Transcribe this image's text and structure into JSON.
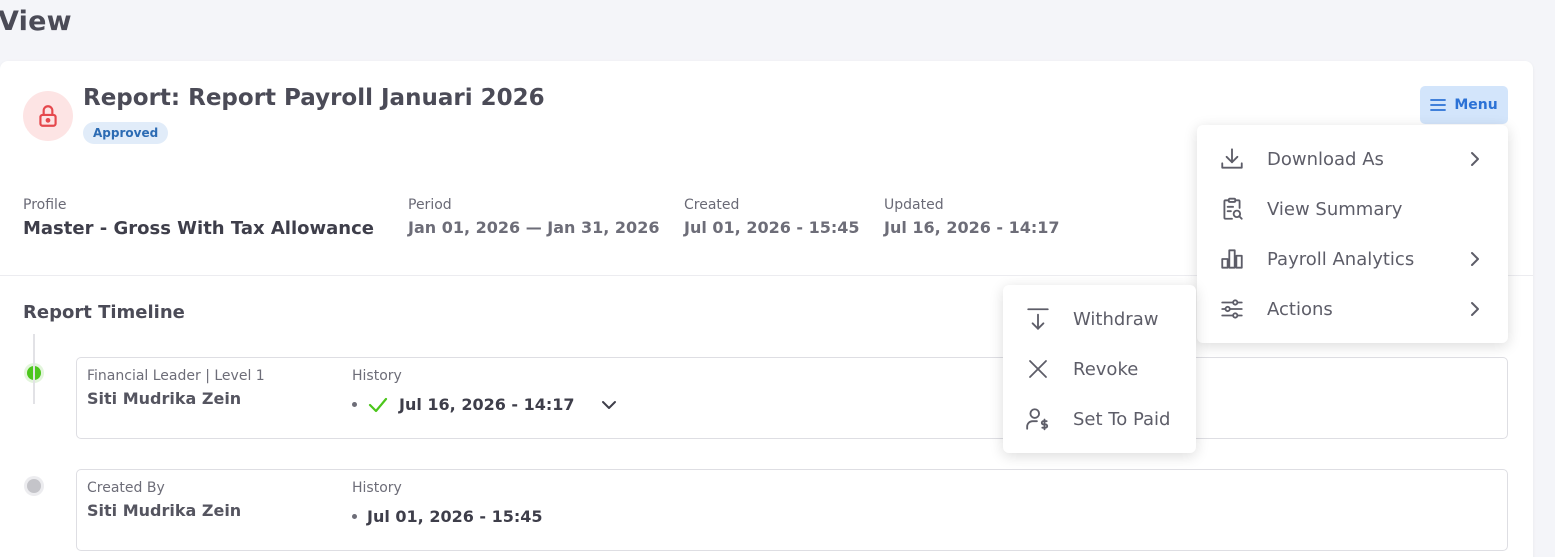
{
  "page": {
    "title": "View"
  },
  "report": {
    "title": "Report: Report Payroll Januari 2026",
    "status": "Approved",
    "menu_label": "Menu"
  },
  "meta": {
    "profile": {
      "label": "Profile",
      "value": "Master - Gross With Tax Allowance"
    },
    "period": {
      "label": "Period",
      "value": "Jan 01, 2026 — Jan 31, 2026"
    },
    "created": {
      "label": "Created",
      "value": "Jul 01, 2026 - 15:45"
    },
    "updated": {
      "label": "Updated",
      "value": "Jul 16, 2026 - 14:17"
    }
  },
  "timeline": {
    "title": "Report Timeline",
    "entries": [
      {
        "role": "Financial Leader | Level 1",
        "name": "Siti Mudrika Zein",
        "history_label": "History",
        "history_value": "Jul 16, 2026 - 14:17",
        "status_color": "#4cc61c"
      },
      {
        "role": "Created By",
        "name": "Siti Mudrika Zein",
        "history_label": "History",
        "history_value": "Jul 01, 2026 - 15:45",
        "status_color": "#c4c4c9"
      }
    ]
  },
  "menu": {
    "items": [
      {
        "label": "Download As",
        "icon": "download-icon",
        "has_submenu": true
      },
      {
        "label": "View Summary",
        "icon": "clipboard-search-icon",
        "has_submenu": false
      },
      {
        "label": "Payroll Analytics",
        "icon": "bar-chart-icon",
        "has_submenu": true
      },
      {
        "label": "Actions",
        "icon": "sliders-icon",
        "has_submenu": true
      }
    ]
  },
  "actions_submenu": {
    "items": [
      {
        "label": "Withdraw",
        "icon": "withdraw-icon"
      },
      {
        "label": "Revoke",
        "icon": "close-icon"
      },
      {
        "label": "Set To Paid",
        "icon": "user-dollar-icon"
      }
    ]
  },
  "colors": {
    "accent": "#2c72d6",
    "success": "#4cc61c",
    "danger": "#e5484d"
  }
}
